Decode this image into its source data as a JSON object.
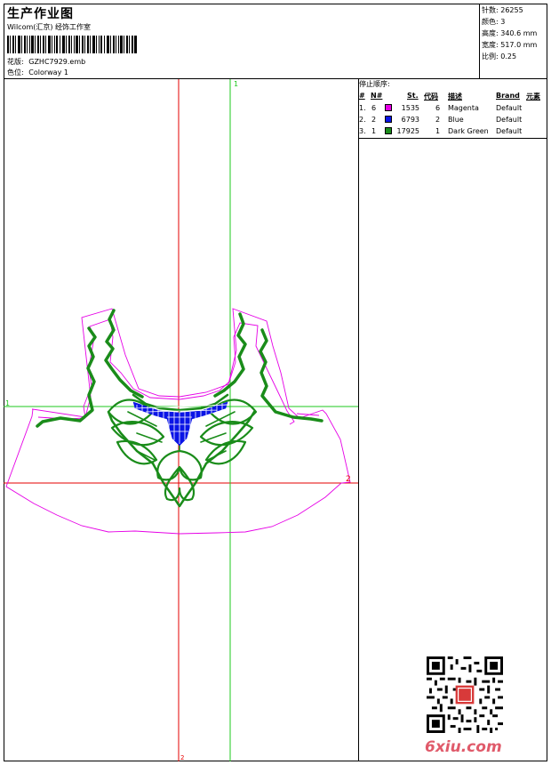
{
  "header": {
    "title": "生产作业图",
    "studio": "Wilcom(汇京) 经饰工作室",
    "design_label": "花版:",
    "design_value": "GZHC7929.emb",
    "colorway_label": "色位:",
    "colorway_value": "Colorway 1"
  },
  "stats": [
    {
      "label": "针数:",
      "value": "26255"
    },
    {
      "label": "颜色:",
      "value": "3"
    },
    {
      "label": "高度:",
      "value": "340.6 mm"
    },
    {
      "label": "宽度:",
      "value": "517.0 mm"
    },
    {
      "label": "比例:",
      "value": "0.25"
    }
  ],
  "stop_sequence": {
    "title": "停止顺序:",
    "columns": [
      "#",
      "N#",
      "St.",
      "代码",
      "描述",
      "Brand",
      "元素"
    ],
    "rows": [
      {
        "index": "1.",
        "n": "6",
        "color": "#e600e6",
        "stitches": "1535",
        "code": "6",
        "description": "Magenta",
        "brand": "Default"
      },
      {
        "index": "2.",
        "n": "2",
        "color": "#0a14e6",
        "stitches": "6793",
        "code": "2",
        "description": "Blue",
        "brand": "Default"
      },
      {
        "index": "3.",
        "n": "1",
        "color": "#1a8c1a",
        "stitches": "17925",
        "code": "1",
        "description": "Dark Green",
        "brand": "Default"
      }
    ]
  },
  "drawing": {
    "axis_labels": {
      "top": "1",
      "left": "1",
      "right": "2",
      "bottom": "2"
    },
    "colors": {
      "outline": "#e600e6",
      "green": "#1a8c1a",
      "blue": "#0a14e6",
      "axis_red": "#e60000",
      "axis_green": "#1ec81e"
    }
  },
  "watermark": "6xiu.com"
}
